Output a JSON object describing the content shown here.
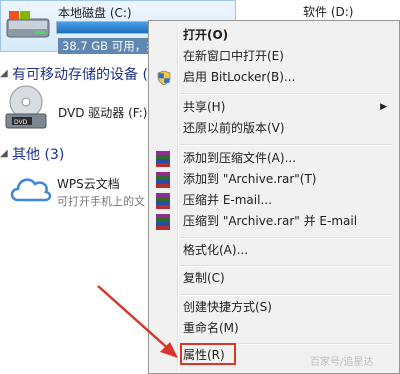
{
  "explorer": {
    "local_disk": {
      "name": "本地磁盘 (C:)",
      "free_text": "38.7 GB 可用，共",
      "usage_fraction": 0.72
    },
    "software_disk": {
      "name": "软件 (D:)"
    },
    "groups": {
      "removable": {
        "title": "有可移动存储的设备 (1)"
      },
      "other": {
        "title": "其他 (3)"
      }
    },
    "dvd": {
      "label": "DVD 驱动器 (F:)"
    },
    "wps": {
      "name": "WPS云文档",
      "subtitle": "可打开手机上的文"
    }
  },
  "context_menu": {
    "open": "打开(O)",
    "open_new_window": "在新窗口中打开(E)",
    "bitlocker": "启用 BitLocker(B)...",
    "share": "共享(H)",
    "restore": "还原以前的版本(V)",
    "add_archive": "添加到压缩文件(A)...",
    "add_archive_rar": "添加到 \"Archive.rar\"(T)",
    "compress_email": "压缩并 E-mail...",
    "compress_rar_email": "压缩到 \"Archive.rar\" 并 E-mail",
    "format": "格式化(A)...",
    "copy": "复制(C)",
    "create_shortcut": "创建快捷方式(S)",
    "rename": "重命名(M)",
    "properties": "属性(R)"
  },
  "watermark": "百家号/追星达",
  "colors": {
    "annotation_red": "#d9362b",
    "drive_bar": "#1c6fbf",
    "group_title": "#1e3287"
  }
}
